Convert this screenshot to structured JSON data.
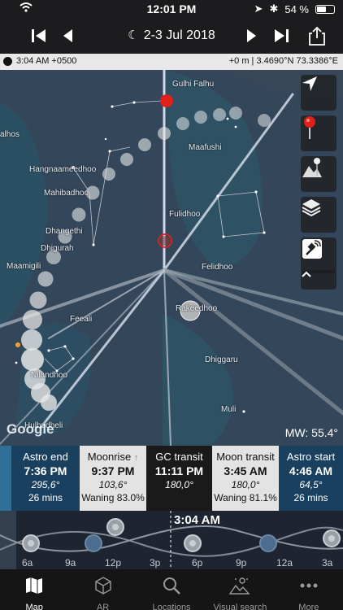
{
  "status_bar": {
    "time": "12:01 PM",
    "battery": "54 %",
    "battery_level": 0.54
  },
  "toolbar": {
    "date": "2-3 Jul 2018"
  },
  "info": {
    "left": "3:04 AM +0500",
    "right": "+0 m | 3.4690°N 73.3386°E"
  },
  "map": {
    "labels": [
      "Gulhi Falhu",
      "alhos",
      "Maafushi",
      "Hangnaameedhoo",
      "Mahibadhoo",
      "Fulidhoo",
      "Dhangethi",
      "Dhigurah",
      "Maamigili",
      "Felidhoo",
      "Feeali",
      "Rakeedhoo",
      "Dhiggaru",
      "Muli",
      "Nilandhoo",
      "Hulhudheli"
    ],
    "attribution": "Google",
    "milky_way": "MW: 55.4°"
  },
  "events": [
    {
      "name": "",
      "time": "",
      "az": "",
      "extra": ""
    },
    {
      "name": "Astro end",
      "time": "7:36 PM",
      "az": "295,6°",
      "extra": "26 mins"
    },
    {
      "name": "Moonrise",
      "time": "9:37 PM",
      "az": "103,6°",
      "extra": "Waning 83.0%"
    },
    {
      "name": "GC transit",
      "time": "11:11 PM",
      "az": "180,0°",
      "extra": ""
    },
    {
      "name": "Moon transit",
      "time": "3:45 AM",
      "az": "180,0°",
      "extra": "Waning 81.1%"
    },
    {
      "name": "Astro start",
      "time": "4:46 AM",
      "az": "64,5°",
      "extra": "26 mins"
    }
  ],
  "timeline": {
    "current_time": "3:04 AM",
    "ticks": [
      "6a",
      "9a",
      "12p",
      "3p",
      "6p",
      "9p",
      "12a",
      "3a"
    ]
  },
  "tabs": [
    {
      "label": "Map",
      "icon": "map-icon"
    },
    {
      "label": "AR",
      "icon": "cube-icon"
    },
    {
      "label": "Locations",
      "icon": "search-icon"
    },
    {
      "label": "Visual search",
      "icon": "visual-search-icon"
    },
    {
      "label": "More",
      "icon": "more-icon"
    }
  ],
  "colors": {
    "accent": "#ffffff",
    "moonrise_bg": "#e3e3e3",
    "moon_transit_bg": "#e3e3e3",
    "gc_bg": "#1a1a1a",
    "astro_bg": "#19405f",
    "sun_marker": "#e0201a"
  }
}
